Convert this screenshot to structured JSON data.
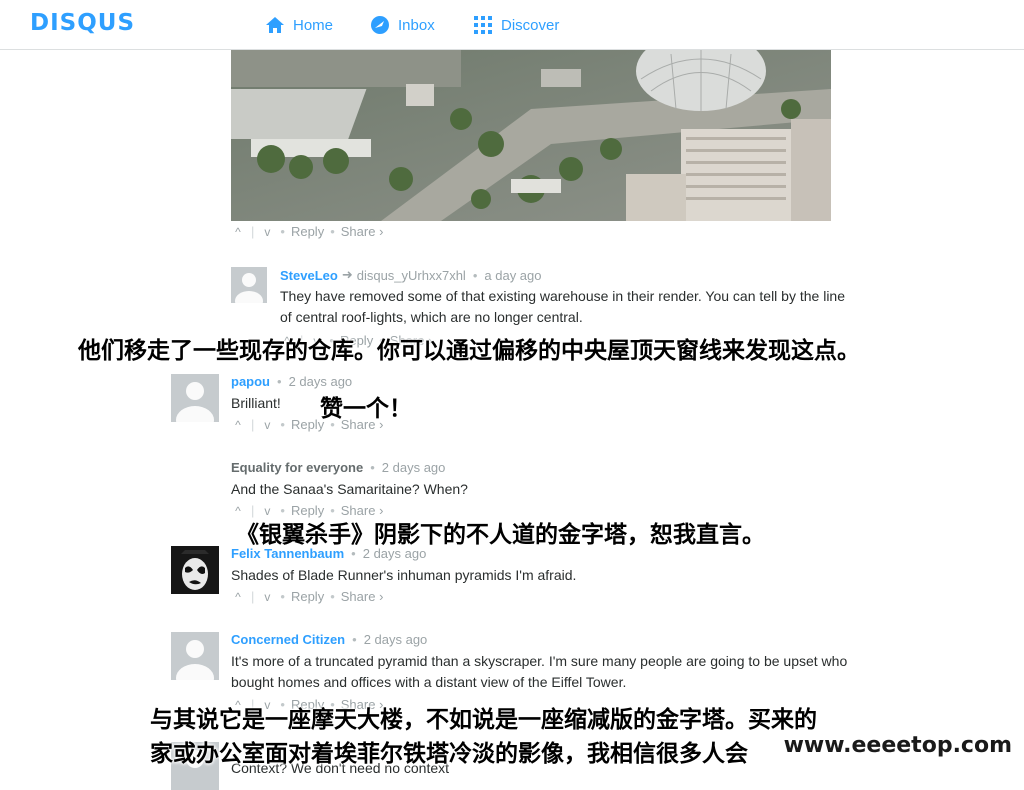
{
  "app": {
    "logo": "DISQUS",
    "accent": "#2e9fff"
  },
  "nav": [
    {
      "label": "Home",
      "icon": "home-icon"
    },
    {
      "label": "Inbox",
      "icon": "inbox-icon"
    },
    {
      "label": "Discover",
      "icon": "discover-icon"
    }
  ],
  "actions": {
    "up": "^",
    "down": "v",
    "reply": "Reply",
    "share": "Share ›"
  },
  "comments": [
    {
      "author": "SteveLeo",
      "via": "disqus_yUrhxx7xhl",
      "time": "a day ago",
      "text": "They have removed some of that existing warehouse in their render. You can tell by the line of central roof-lights, which are no longer central."
    },
    {
      "author": "papou",
      "time": "2 days ago",
      "text": "Brilliant!"
    },
    {
      "author": "Equality for everyone",
      "time": "2 days ago",
      "text": "And the Sanaa's Samaritaine? When?"
    },
    {
      "author": "Felix Tannenbaum",
      "time": "2 days ago",
      "text": "Shades of Blade Runner's inhuman pyramids I'm afraid."
    },
    {
      "author": "Concerned Citizen",
      "time": "2 days ago",
      "text": "It's more of a truncated pyramid than a skyscraper. I'm sure many people are going to be upset who bought homes and offices with a distant view of the Eiffel Tower."
    },
    {
      "text": "Context? We don't need no context"
    }
  ],
  "subtitles": [
    "他们移走了一些现存的仓库。你可以通过偏移的中央屋顶天窗线来发现这点。",
    "赞一个！",
    "《银翼杀手》阴影下的不人道的金字塔，恕我直言。",
    "与其说它是一座摩天大楼，不如说是一座缩减版的金字塔。买来的",
    "家或办公室面对着埃菲尔铁塔冷淡的影像，我相信很多人会"
  ],
  "watermark": "www.eeeetop.com"
}
